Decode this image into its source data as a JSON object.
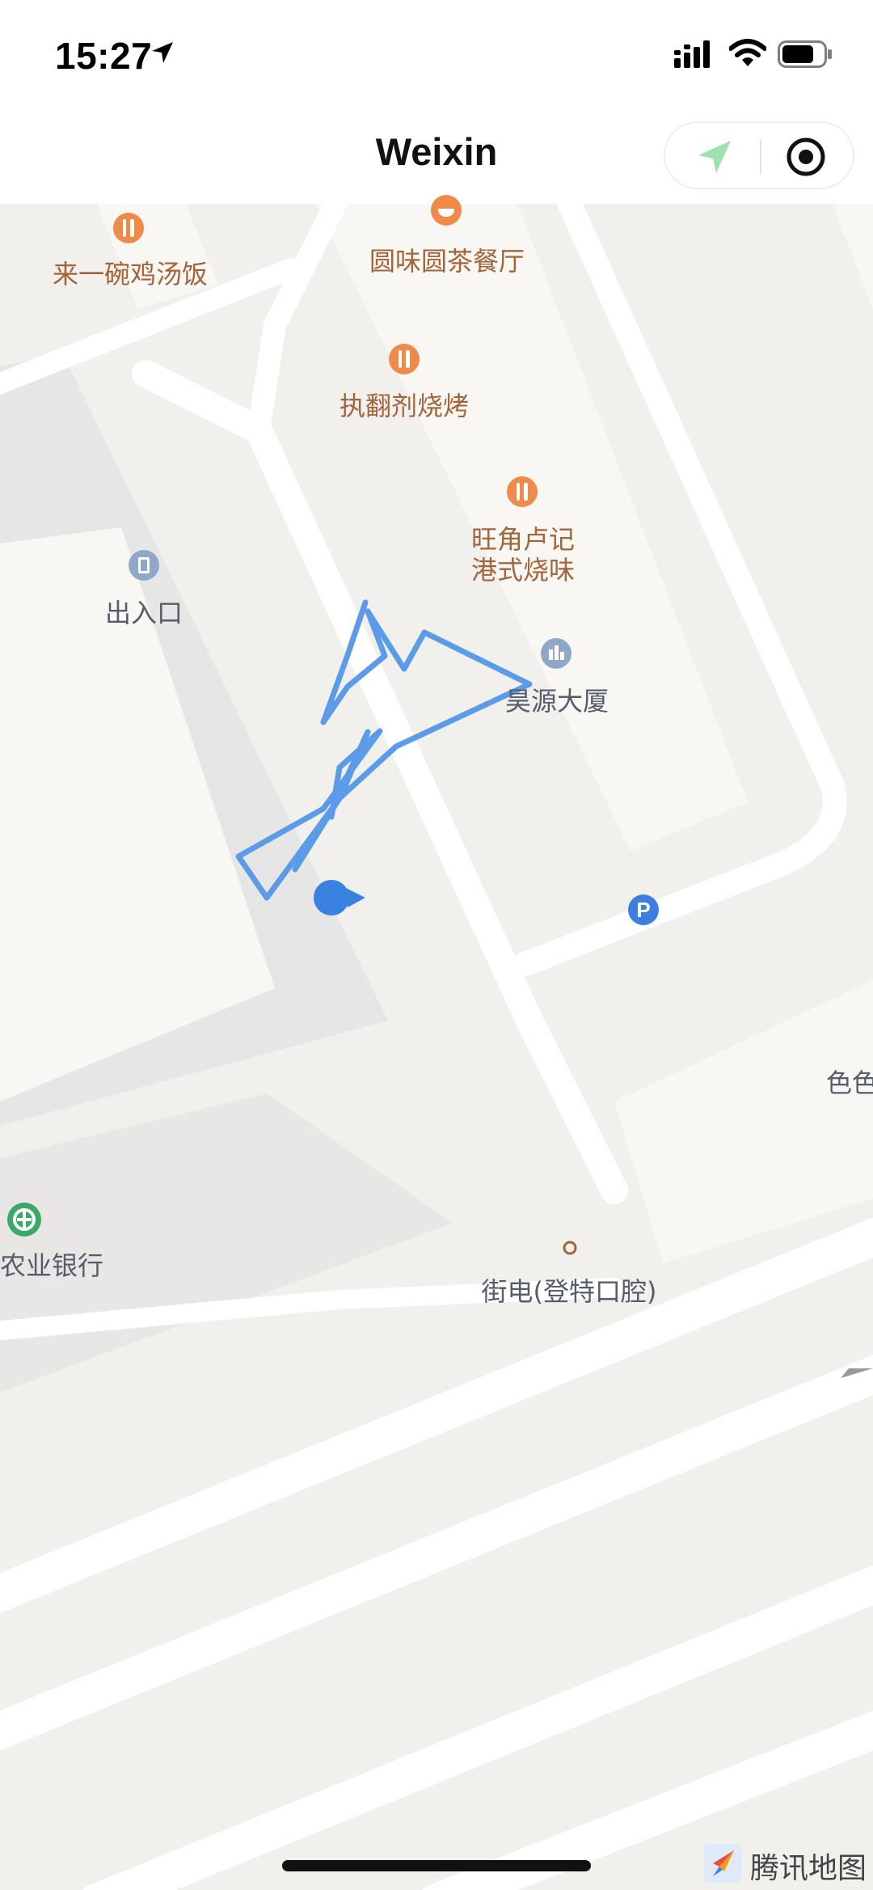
{
  "status_bar": {
    "time": "15:27"
  },
  "nav_bar": {
    "title": "Weixin"
  },
  "map": {
    "pois": {
      "laiyiwan": "来一碗鸡汤饭",
      "yuanweiyuan": "圆味圆茶餐厅",
      "zhifanji": "执翻剂烧烤",
      "wangjiao_line1": "旺角卢记",
      "wangjiao_line2": "港式烧味",
      "entrance": "出入口",
      "haoyuan": "昊源大厦",
      "bank": "农业银行",
      "jiedian": "街电(登特口腔)",
      "color_partial": "色色"
    },
    "parking_icon": "P"
  },
  "watermark": {
    "text": "腾讯地图"
  },
  "colors": {
    "map_background": "#f1f0ed",
    "building_light": "#f8f7f3",
    "building_gray": "#e6e6e6",
    "road": "#ffffff",
    "track": "#5b9be8",
    "location_dot": "#3a82e0",
    "food_icon": "#f08a4b",
    "nav_arrow": "#9ee0b0"
  },
  "icons": [
    "location-arrow-icon",
    "signal-icon",
    "wifi-icon",
    "battery-icon",
    "navigation-icon",
    "locate-target-icon",
    "restaurant-icon",
    "entrance-icon",
    "building-icon",
    "parking-icon",
    "bank-icon",
    "shop-icon",
    "tencent-map-logo-icon"
  ]
}
